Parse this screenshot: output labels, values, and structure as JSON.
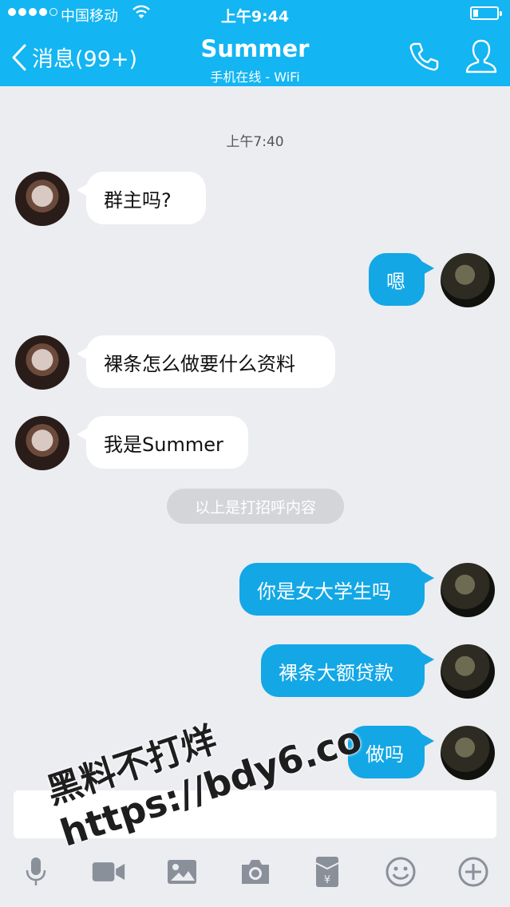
{
  "status_bar": {
    "carrier": "中国移动",
    "time": "上午9:44",
    "signal_bars_filled": 4,
    "signal_bars_total": 5
  },
  "header": {
    "back_label": "消息(99+)",
    "contact_name": "Summer",
    "presence": "手机在线 - WiFi",
    "icons": [
      "chevron-left-icon",
      "phone-icon",
      "person-icon"
    ]
  },
  "chat": {
    "timestamp": "上午7:40",
    "messages": [
      {
        "from": "contact",
        "text": "群主吗?"
      },
      {
        "from": "me",
        "text": "嗯"
      },
      {
        "from": "contact",
        "text": "裸条怎么做要什么资料"
      },
      {
        "from": "contact",
        "text": "我是Summer"
      },
      {
        "from": "me",
        "text": "你是女大学生吗"
      },
      {
        "from": "me",
        "text": "裸条大额贷款"
      },
      {
        "from": "me",
        "text": "做吗"
      }
    ],
    "system_note": "以上是打招呼内容"
  },
  "input": {
    "value": ""
  },
  "toolbar": {
    "items": [
      "microphone-icon",
      "video-icon",
      "image-icon",
      "camera-icon",
      "red-packet-icon",
      "emoji-icon",
      "plus-icon"
    ]
  },
  "watermark": {
    "line1": "黑料不打烊",
    "line2": "https://bdy6.co"
  },
  "colors": {
    "header": "#13b5f2",
    "outgoing_bubble": "#13a7e6",
    "background": "#ebedf1"
  }
}
